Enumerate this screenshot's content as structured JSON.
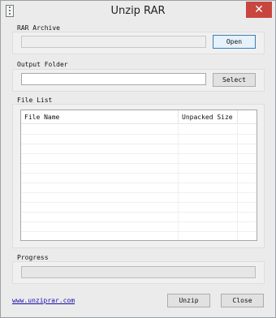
{
  "window": {
    "title": "Unzip RAR"
  },
  "rar_archive": {
    "label": "RAR Archive",
    "value": "",
    "button": "Open"
  },
  "output_folder": {
    "label": "Output Folder",
    "value": "",
    "button": "Select"
  },
  "file_list": {
    "label": "File List",
    "columns": [
      "File Name",
      "Unpacked Size"
    ],
    "rows": []
  },
  "progress": {
    "label": "Progress",
    "value": 0
  },
  "footer": {
    "link": "www.unziprar.com",
    "unzip_button": "Unzip",
    "close_button": "Close"
  },
  "colors": {
    "close_button": "#c7463e",
    "progress_fill": "#06b025",
    "link": "#1a0dab"
  },
  "icons": {
    "app": "archive-icon",
    "close": "close-icon"
  }
}
